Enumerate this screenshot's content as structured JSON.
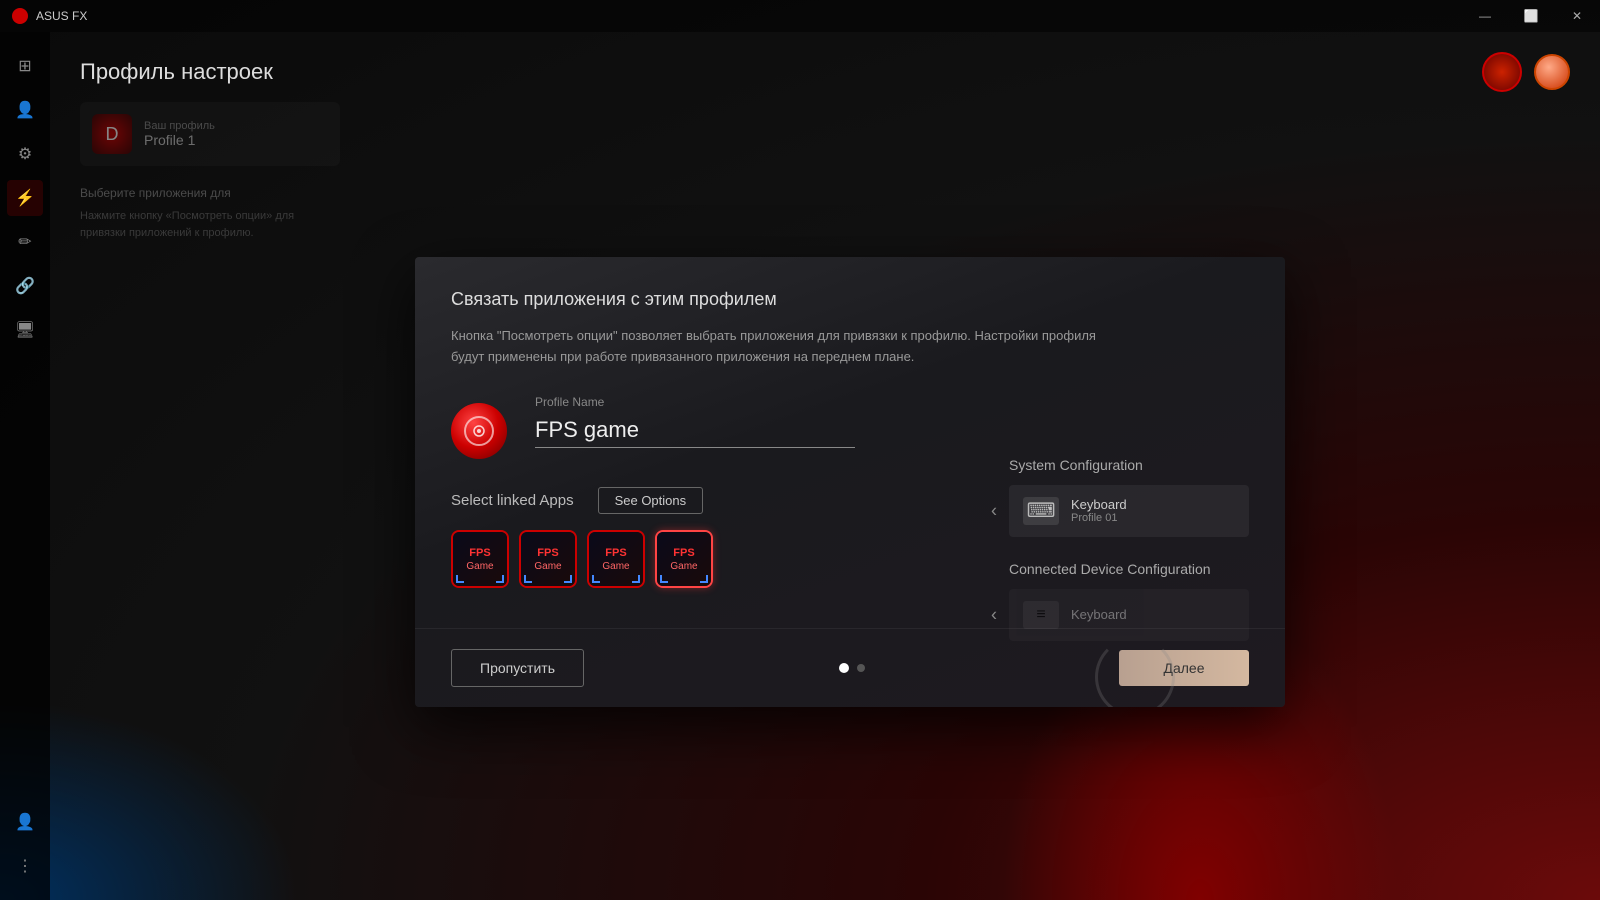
{
  "app": {
    "title": "ASUS FX",
    "window_title": "ASUS FX"
  },
  "titlebar": {
    "minimize_label": "—",
    "restore_label": "⬜",
    "close_label": "✕"
  },
  "page": {
    "title": "Профиль настроек"
  },
  "sidebar": {
    "items": [
      {
        "id": "home",
        "icon": "⊞",
        "active": false
      },
      {
        "id": "profile",
        "icon": "👤",
        "active": false
      },
      {
        "id": "settings",
        "icon": "⚙",
        "active": false
      },
      {
        "id": "lightning",
        "icon": "⚡",
        "active": true
      },
      {
        "id": "brush",
        "icon": "🖌",
        "active": false
      },
      {
        "id": "link",
        "icon": "🔗",
        "active": false
      },
      {
        "id": "monitor",
        "icon": "🖥",
        "active": false
      }
    ],
    "bottom_items": [
      {
        "id": "user",
        "icon": "👤"
      },
      {
        "id": "more",
        "icon": "⋮"
      }
    ]
  },
  "left_panel": {
    "profile_label": "Ваш профиль",
    "profile_name": "Profile 1",
    "section_label": "Выберите приложения для",
    "hint_text": "Нажмите кнопку «Посмотреть опции» для привязки приложений к профилю."
  },
  "modal": {
    "heading": "Связать приложения с этим профилем",
    "description": "Кнопка \"Посмотреть опции\" позволяет выбрать приложения для привязки к профилю. Настройки профиля будут применены при работе привязанного приложения на переднем плане.",
    "profile_name_label": "Profile Name",
    "profile_name_value": "FPS game",
    "select_linked_apps_label": "Select linked Apps",
    "see_options_label": "See Options",
    "system_config_title": "System Configuration",
    "keyboard_label": "Keyboard",
    "keyboard_profile": "Profile 01",
    "keyboard_profile_full": "Keyboard Profile 01",
    "connected_device_title": "Connected Device Configuration",
    "connected_keyboard_label": "Keyboard",
    "app_icons": [
      {
        "label": "FPS\nGame",
        "selected": false
      },
      {
        "label": "FPS\nGame",
        "selected": false
      },
      {
        "label": "FPS\nGame",
        "selected": false
      },
      {
        "label": "FPS\nGame",
        "selected": true
      }
    ],
    "footer": {
      "skip_label": "Пропустить",
      "next_label": "Далее"
    },
    "pagination": {
      "total": 2,
      "current": 0
    }
  }
}
